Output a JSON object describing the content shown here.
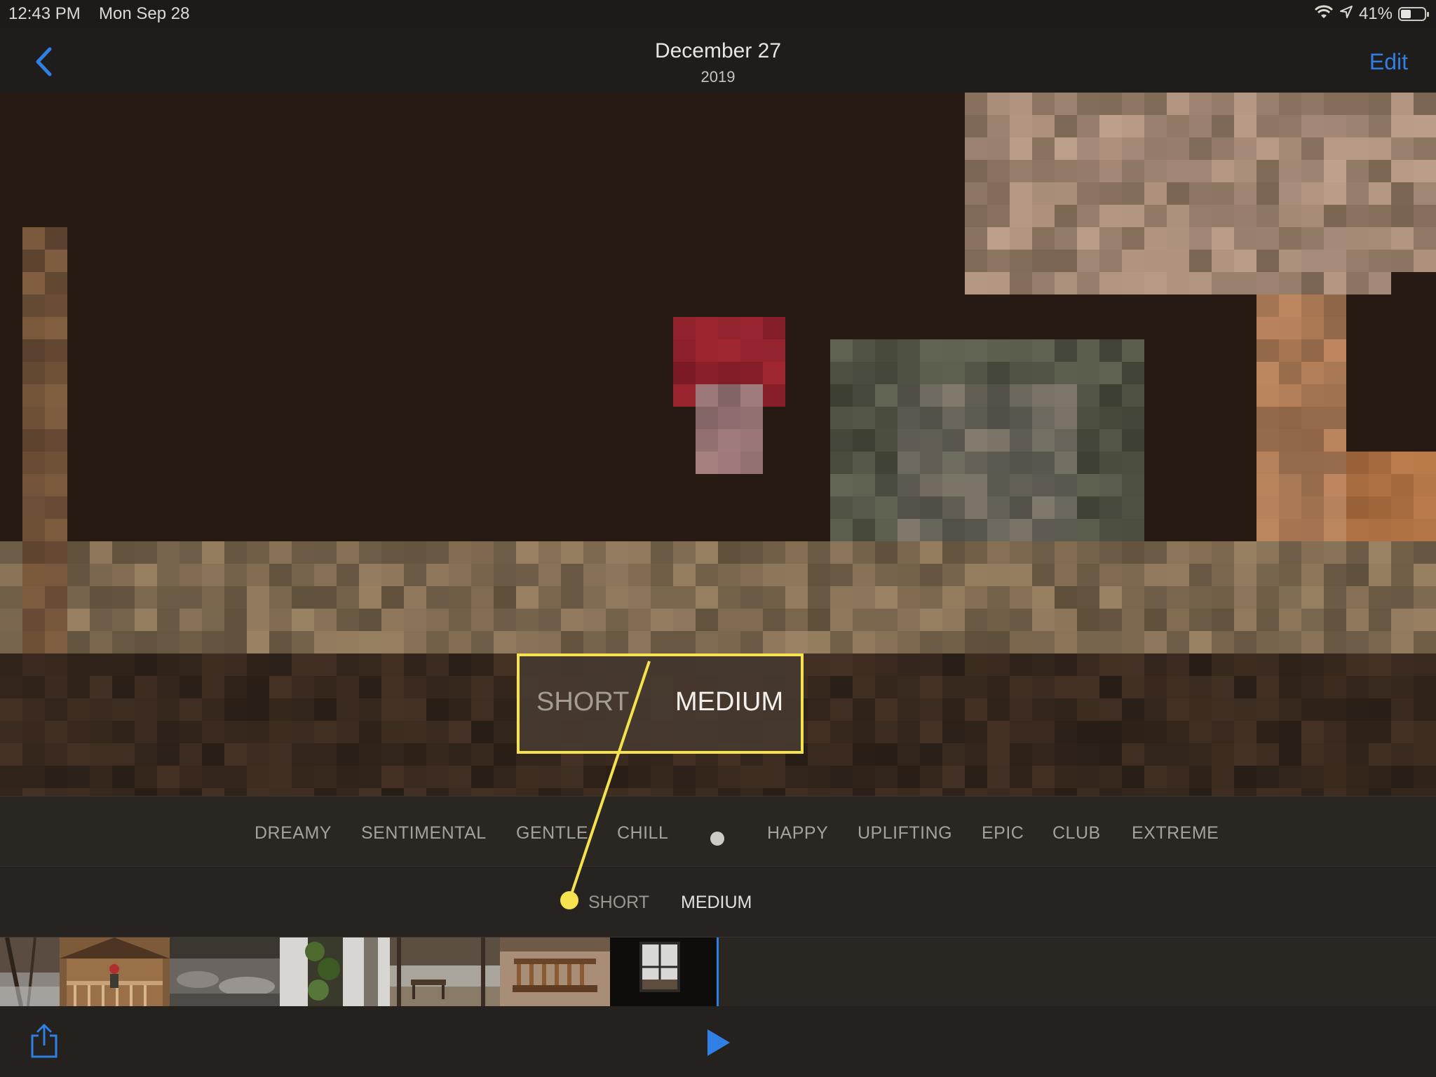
{
  "status_bar": {
    "time": "12:43 PM",
    "date": "Mon Sep 28",
    "battery": "41%",
    "icons": [
      "wifi-icon",
      "location-arrow-icon",
      "battery-icon"
    ]
  },
  "nav": {
    "title": "December 27",
    "subtitle": "2019",
    "edit_label": "Edit",
    "back_icon": "chevron-left-icon"
  },
  "callout": {
    "short_label": "SHORT",
    "medium_label": "MEDIUM",
    "highlight_color": "#f5e24e"
  },
  "moods": {
    "left": [
      "DREAMY",
      "SENTIMENTAL",
      "GENTLE",
      "CHILL"
    ],
    "right": [
      "HAPPY",
      "UPLIFTING",
      "EPIC",
      "CLUB",
      "EXTREME"
    ],
    "items": [
      {
        "label": "DREAMY"
      },
      {
        "label": "SENTIMENTAL"
      },
      {
        "label": "GENTLE"
      },
      {
        "label": "CHILL"
      },
      {
        "label": "HAPPY"
      },
      {
        "label": "UPLIFTING"
      },
      {
        "label": "EPIC"
      },
      {
        "label": "CLUB"
      },
      {
        "label": "EXTREME"
      }
    ]
  },
  "duration": {
    "short_label": "SHORT",
    "medium_label": "MEDIUM",
    "selected": "MEDIUM"
  },
  "filmstrip": {
    "thumbnails": [
      "forest-stream",
      "cabin-porch",
      "river-rocks",
      "ivy-tree",
      "creek-bench",
      "porch-swing",
      "cabin-window"
    ]
  },
  "toolbar": {
    "share_icon": "share-icon",
    "play_icon": "play-icon"
  },
  "colors": {
    "accent": "#2f7fe5",
    "callout": "#f5e24e"
  }
}
